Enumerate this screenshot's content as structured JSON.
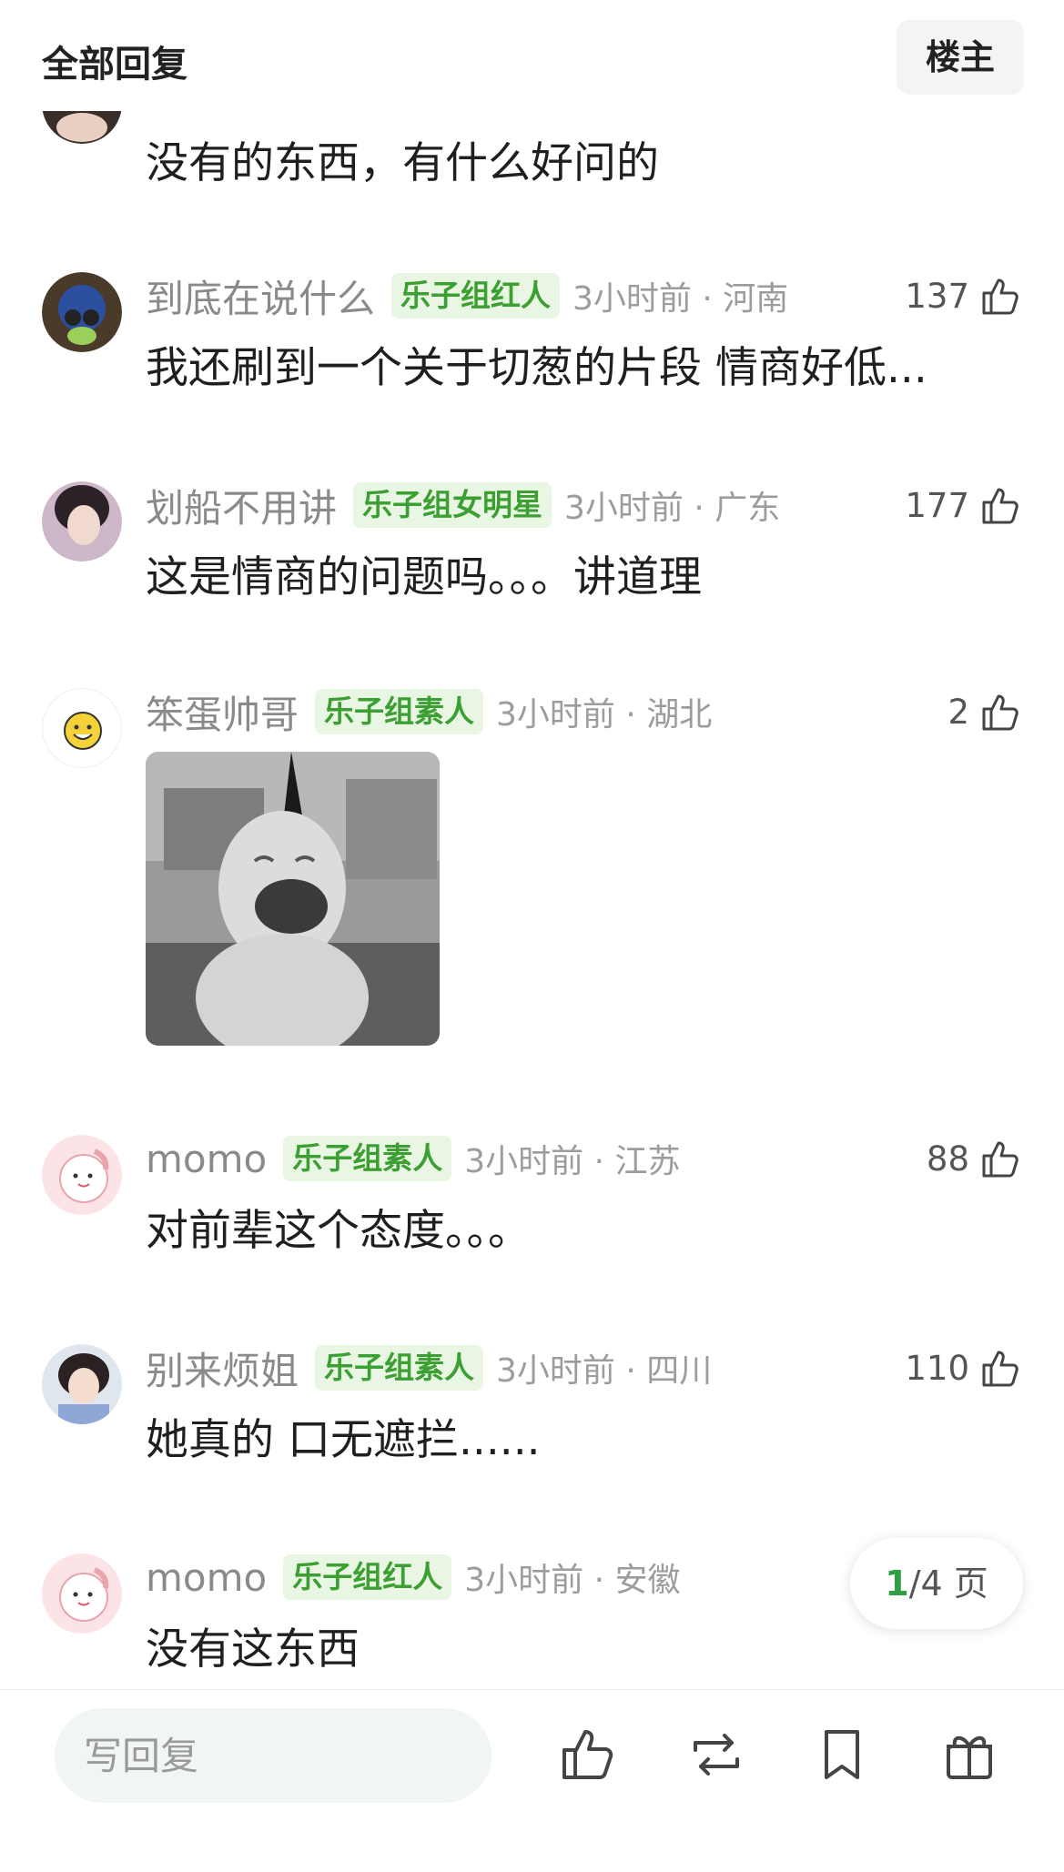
{
  "header": {
    "title": "全部回复",
    "owner_button": "楼主"
  },
  "comments": [
    {
      "text": "没有的东西，有什么好问的"
    },
    {
      "username": "到底在说什么",
      "badge": "乐子组红人",
      "time_location": "3小时前 · 河南",
      "likes": "137",
      "text": "我还刷到一个关于切葱的片段 情商好低..."
    },
    {
      "username": "划船不用讲",
      "badge": "乐子组女明星",
      "time_location": "3小时前 · 广东",
      "likes": "177",
      "text": "这是情商的问题吗。。。讲道理"
    },
    {
      "username": "笨蛋帅哥",
      "badge": "乐子组素人",
      "time_location": "3小时前 · 湖北",
      "likes": "2",
      "has_sticker": true
    },
    {
      "username": "momo",
      "badge": "乐子组素人",
      "time_location": "3小时前 · 江苏",
      "likes": "88",
      "text": "对前辈这个态度。。。"
    },
    {
      "username": "别来烦姐",
      "badge": "乐子组素人",
      "time_location": "3小时前 · 四川",
      "likes": "110",
      "text": "她真的 口无遮拦......"
    },
    {
      "username": "momo",
      "badge": "乐子组红人",
      "time_location": "3小时前 · 安徽",
      "likes": "",
      "text": "没有这东西"
    }
  ],
  "pager": {
    "current": "1",
    "total_suffix": "/4 页"
  },
  "bottom_bar": {
    "reply_placeholder": "写回复",
    "icons": [
      "like-icon",
      "repost-icon",
      "bookmark-icon",
      "gift-icon"
    ]
  },
  "colors": {
    "badge_bg": "#e9f6e4",
    "badge_text": "#3c9f32",
    "accent": "#2ea043"
  }
}
